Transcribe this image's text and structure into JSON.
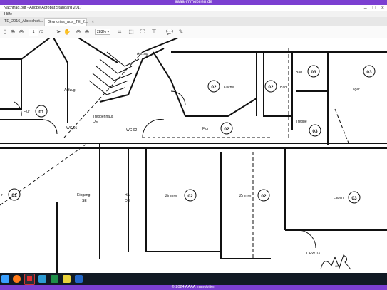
{
  "banner": {
    "text": "aaaa-immobilien.de"
  },
  "window": {
    "title": "_Nachtrag.pdf - Adobe Acrobat Standard 2017"
  },
  "menu": {
    "items": [
      "Hilfe"
    ]
  },
  "tabs": [
    {
      "label": "TE_2016_Albrechtst...",
      "close": "×"
    },
    {
      "label": "Grundriss_aus_TE_2...",
      "close": "×"
    }
  ],
  "toolbar": {
    "page_current": "1",
    "page_total": "/ 3",
    "zoom": "283%"
  },
  "plan": {
    "labels": {
      "aufzug_top": "Aufzug",
      "aufzug": "Aufzug",
      "flur_left": "Flur",
      "treppenhaus": "Treppenhaus",
      "treppenhaus_code": "OE",
      "wc_left": "WC 01",
      "wc_mid": "WC 02",
      "kueche": "Küche",
      "bad": "Bad",
      "lager": "Lager",
      "flur_mid": "Flur",
      "treppe": "Treppe",
      "eingang": "Eingang",
      "eingang_code": "SE",
      "ha": "HA",
      "ha_code": "OE",
      "zimmer1": "Zimmer",
      "zimmer2": "Zimmer",
      "laden": "Laden",
      "left_room": "r",
      "wc_bottom": "OEW 03",
      "scribble": "GNR"
    },
    "units": {
      "u01a": "01",
      "u01b": "01",
      "u02k": "02",
      "u02b": "02",
      "u02f": "02",
      "u02z1": "02",
      "u02z2": "02",
      "u03a": "03",
      "u03b": "03",
      "u03c": "03",
      "u03l": "03"
    }
  },
  "footer": {
    "text": "© 2024 AAAA Immobilien"
  }
}
